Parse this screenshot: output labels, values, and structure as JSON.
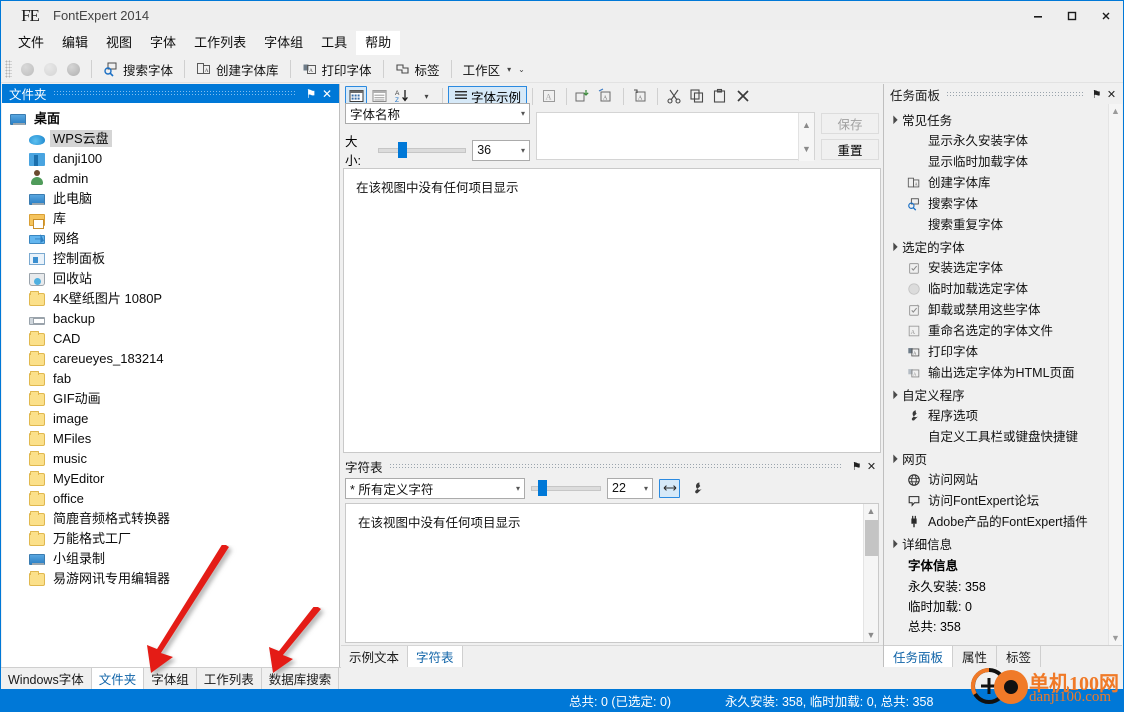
{
  "window": {
    "logo": "FE",
    "title": "FontExpert 2014",
    "minimize": "–",
    "maximize": "❐",
    "close": "✕"
  },
  "menubar": {
    "items": [
      {
        "label": "文件"
      },
      {
        "label": "编辑"
      },
      {
        "label": "视图"
      },
      {
        "label": "字体"
      },
      {
        "label": "工作列表"
      },
      {
        "label": "字体组"
      },
      {
        "label": "工具"
      },
      {
        "label": "帮助",
        "highlight": true
      }
    ]
  },
  "toolbar": {
    "buttons": [
      {
        "label": "搜索字体",
        "icon": "search-font-icon"
      },
      {
        "label": "创建字体库",
        "icon": "create-library-icon"
      },
      {
        "label": "打印字体",
        "icon": "print-font-icon"
      },
      {
        "label": "标签",
        "icon": "tag-icon"
      },
      {
        "label": "工作区",
        "icon": "workspace-icon",
        "caret": "▾"
      }
    ]
  },
  "left_pane": {
    "caption": "文件夹",
    "pin": "⚑",
    "close": "✕",
    "tree": [
      {
        "label": "桌面",
        "icon": "desktop-icon",
        "level": 0
      },
      {
        "label": "WPS云盘",
        "icon": "cloud-icon",
        "level": 1,
        "selected": true
      },
      {
        "label": "danji100",
        "icon": "chart-icon",
        "level": 1
      },
      {
        "label": "admin",
        "icon": "user-icon",
        "level": 1
      },
      {
        "label": "此电脑",
        "icon": "computer-icon",
        "level": 1
      },
      {
        "label": "库",
        "icon": "library-icon",
        "level": 1
      },
      {
        "label": "网络",
        "icon": "network-icon",
        "level": 1
      },
      {
        "label": "控制面板",
        "icon": "control-panel-icon",
        "level": 1
      },
      {
        "label": "回收站",
        "icon": "recycle-bin-icon",
        "level": 1
      },
      {
        "label": "4K壁纸图片 1080P",
        "icon": "folder-icon",
        "level": 1
      },
      {
        "label": "backup",
        "icon": "printer-folder-icon",
        "level": 1
      },
      {
        "label": "CAD",
        "icon": "folder-icon",
        "level": 1
      },
      {
        "label": "careueyes_183214",
        "icon": "folder-icon",
        "level": 1
      },
      {
        "label": "fab",
        "icon": "folder-icon",
        "level": 1
      },
      {
        "label": "GIF动画",
        "icon": "folder-icon",
        "level": 1
      },
      {
        "label": "image",
        "icon": "folder-icon",
        "level": 1
      },
      {
        "label": "MFiles",
        "icon": "folder-icon",
        "level": 1
      },
      {
        "label": "music",
        "icon": "folder-icon",
        "level": 1
      },
      {
        "label": "MyEditor",
        "icon": "folder-icon",
        "level": 1
      },
      {
        "label": "office",
        "icon": "folder-icon",
        "level": 1
      },
      {
        "label": "简鹿音频格式转换器",
        "icon": "folder-icon",
        "level": 1
      },
      {
        "label": "万能格式工厂",
        "icon": "folder-icon",
        "level": 1
      },
      {
        "label": "小组录制",
        "icon": "computer-icon",
        "level": 1
      },
      {
        "label": "易游网讯专用编辑器",
        "icon": "folder-icon",
        "level": 1
      }
    ],
    "tabs": [
      {
        "label": "Windows字体",
        "active": false
      },
      {
        "label": "文件夹",
        "active": true
      },
      {
        "label": "字体组",
        "active": false
      },
      {
        "label": "工作列表",
        "active": false
      },
      {
        "label": "数据库搜索",
        "active": false
      }
    ]
  },
  "center": {
    "toolbar": {
      "sample_label": "字体示例",
      "icons": [
        "grid-view-icon",
        "list-view-icon",
        "sort-az-icon",
        "sort-caret-icon",
        "sample-lines-icon",
        "font-box-icon",
        "install-font-icon",
        "load-font-icon",
        "unload-font-icon",
        "cut-icon",
        "copy-icon",
        "paste-icon",
        "delete-icon"
      ]
    },
    "font_name_label": "字体名称",
    "size_label": "大小:",
    "size_value": "36",
    "preview_text": "",
    "save_button": "保存",
    "reset_button": "重置",
    "empty_message": "在该视图中没有任何项目显示",
    "charmap": {
      "caption": "字符表",
      "pin": "⚑",
      "close": "✕",
      "filter_value": "* 所有定义字符",
      "size_value": "22",
      "empty_message": "在该视图中没有任何项目显示"
    },
    "tabs": [
      {
        "label": "示例文本",
        "active": false
      },
      {
        "label": "字符表",
        "active": true
      }
    ]
  },
  "right_pane": {
    "caption": "任务面板",
    "pin": "⚑",
    "close": "✕",
    "sections": [
      {
        "title": "常见任务",
        "items": [
          {
            "label": "显示永久安装字体",
            "icon": ""
          },
          {
            "label": "显示临时加载字体",
            "icon": ""
          },
          {
            "label": "创建字体库",
            "icon": "create-library-icon"
          },
          {
            "label": "搜索字体",
            "icon": "search-font-icon"
          },
          {
            "label": "搜索重复字体",
            "icon": ""
          }
        ]
      },
      {
        "title": "选定的字体",
        "items": [
          {
            "label": "安装选定字体",
            "icon": "install-check-icon"
          },
          {
            "label": "临时加载选定字体",
            "icon": "circle-icon"
          },
          {
            "label": "卸载或禁用这些字体",
            "icon": "uninstall-check-icon"
          },
          {
            "label": "重命名选定的字体文件",
            "icon": "rename-icon"
          },
          {
            "label": "打印字体",
            "icon": "print-font-icon"
          },
          {
            "label": "输出选定字体为HTML页面",
            "icon": "export-html-icon"
          }
        ]
      },
      {
        "title": "自定义程序",
        "items": [
          {
            "label": "程序选项",
            "icon": "wrench-icon"
          },
          {
            "label": "自定义工具栏或键盘快捷键",
            "icon": ""
          }
        ]
      },
      {
        "title": "网页",
        "items": [
          {
            "label": "访问网站",
            "icon": "globe-icon"
          },
          {
            "label": "访问FontExpert论坛",
            "icon": "forum-icon"
          },
          {
            "label": "Adobe产品的FontExpert插件",
            "icon": "plugin-icon"
          }
        ]
      }
    ],
    "details": {
      "title": "详细信息",
      "subtitle": "字体信息",
      "lines": [
        "永久安装: 358",
        "临时加载: 0",
        "总共: 358"
      ]
    },
    "tabs": [
      {
        "label": "任务面板",
        "active": true
      },
      {
        "label": "属性",
        "active": false
      },
      {
        "label": "标签",
        "active": false
      }
    ]
  },
  "statusbar": {
    "total": "总共: 0 (已选定: 0)",
    "summary": "永久安装: 358, 临时加载: 0, 总共: 358"
  },
  "watermark": {
    "line1": "单机100网",
    "line2": "danji100.com"
  },
  "colors": {
    "accent": "#0078d7",
    "panel_bg": "#f0f0f0",
    "arrow_red": "#e41b13"
  }
}
